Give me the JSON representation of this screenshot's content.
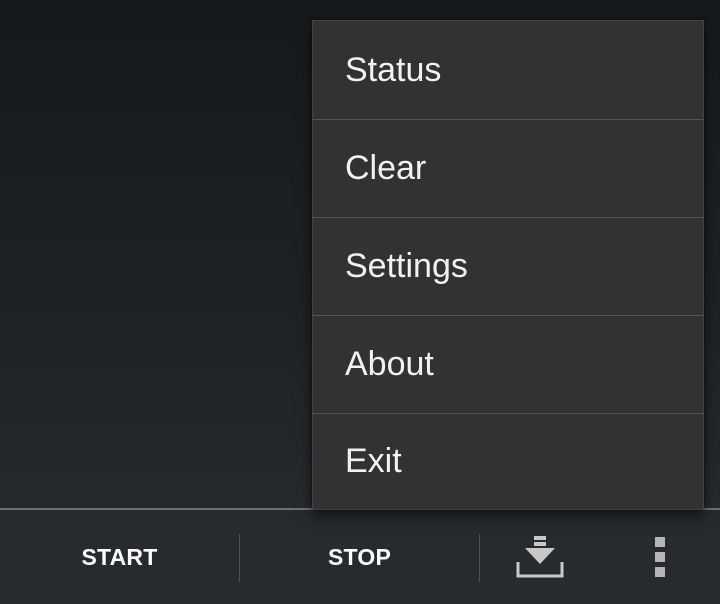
{
  "menu": {
    "items": [
      {
        "label": "Status"
      },
      {
        "label": "Clear"
      },
      {
        "label": "Settings"
      },
      {
        "label": "About"
      },
      {
        "label": "Exit"
      }
    ]
  },
  "action_bar": {
    "start_label": "START",
    "stop_label": "STOP",
    "download_icon": "download-icon",
    "overflow_icon": "overflow-menu-icon"
  },
  "colors": {
    "background_top": "#16191c",
    "background_bottom": "#2a2e33",
    "menu_background": "#323232",
    "menu_text": "#f2f2f2",
    "action_bar_text": "#ffffff",
    "icon_color": "#c8c8c8"
  }
}
